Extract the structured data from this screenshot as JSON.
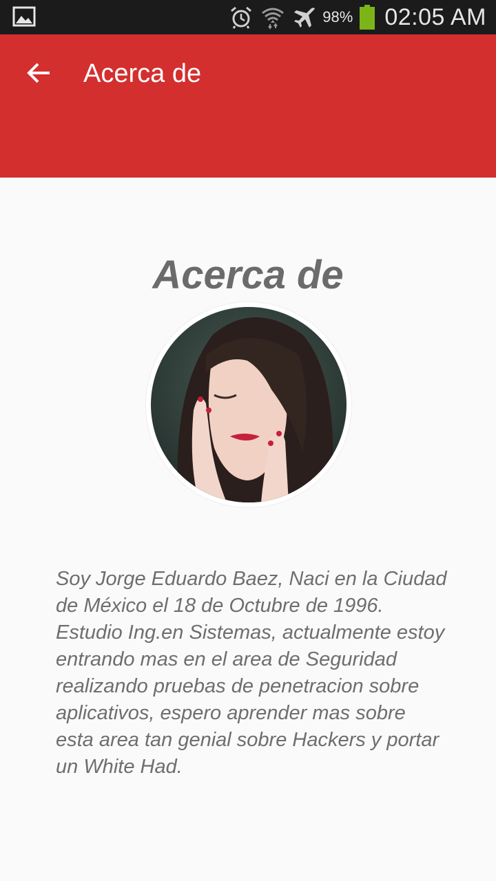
{
  "status_bar": {
    "left_icon": "gallery-icon",
    "icons": [
      "alarm-icon",
      "wifi-icon",
      "airplane-icon",
      "battery-icon"
    ],
    "battery_percent": "98%",
    "time": "02:05 AM",
    "battery_color": "#7cb518"
  },
  "app_bar": {
    "back_icon": "arrow-left-icon",
    "title": "Acerca de",
    "color": "#d32f2f"
  },
  "content": {
    "heading": "Acerca de",
    "avatar_icon": "profile-photo",
    "bio": "Soy Jorge Eduardo Baez, Naci en la Ciudad de México el 18 de Octubre de 1996. Estudio Ing.en Sistemas, actualmente estoy entrando mas en el area de Seguridad realizando pruebas de penetracion sobre aplicativos, espero aprender mas sobre esta area tan genial sobre Hackers y portar un White Had."
  }
}
